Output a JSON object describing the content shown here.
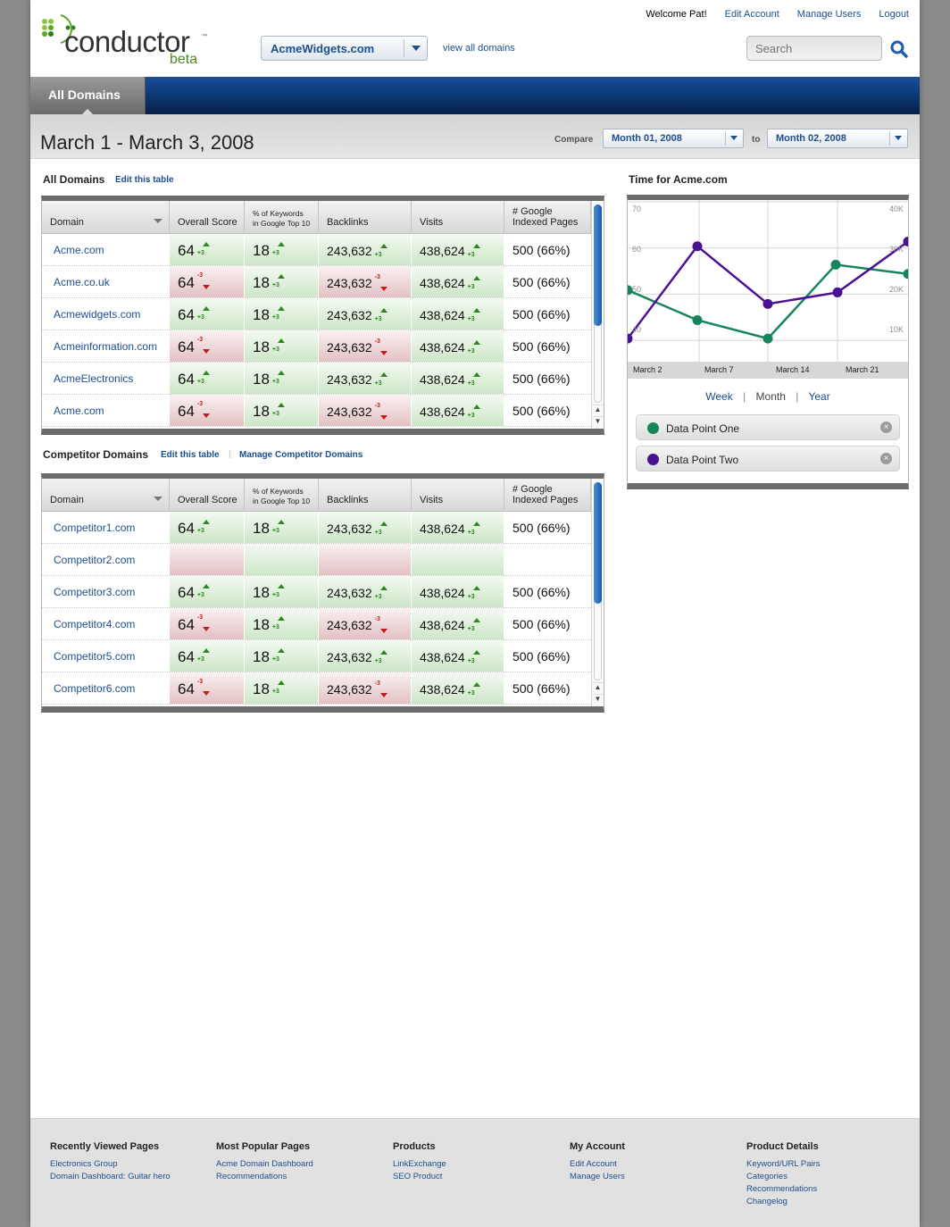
{
  "brand": {
    "name": "conductor",
    "sub": "beta",
    "tm": "™"
  },
  "toplinks": {
    "welcome": "Welcome Pat!",
    "edit_account": "Edit Account",
    "manage_users": "Manage Users",
    "logout": "Logout"
  },
  "domain_selector": {
    "value": "AcmeWidgets.com"
  },
  "view_all": "view all domains",
  "search": {
    "placeholder": "Search"
  },
  "nav": {
    "active_tab": "All Domains"
  },
  "date_range": "March 1 - March 3, 2008",
  "compare": {
    "label": "Compare",
    "from": "Month 01, 2008",
    "to_label": "to",
    "to": "Month 02, 2008"
  },
  "all_domains": {
    "title": "All Domains",
    "edit": "Edit this table",
    "headers": {
      "domain": "Domain",
      "score": "Overall Score",
      "kw1": "% of Keywords",
      "kw2": "in Google Top 10",
      "backlinks": "Backlinks",
      "visits": "Visits",
      "idx1": "# Google",
      "idx2": "Indexed Pages"
    },
    "rows": [
      {
        "domain": "Acme.com",
        "score": "64",
        "score_delta": "+3",
        "kw": "18",
        "kw_delta": "+3",
        "backlinks": "243,632",
        "bl_delta": "+3",
        "visits": "438,624",
        "v_delta": "+3",
        "indexed": "500 (66%)"
      },
      {
        "domain": "Acme.co.uk",
        "score": "64",
        "score_delta": "-3",
        "kw": "18",
        "kw_delta": "+3",
        "backlinks": "243,632",
        "bl_delta": "-3",
        "visits": "438,624",
        "v_delta": "+3",
        "indexed": "500 (66%)"
      },
      {
        "domain": "Acmewidgets.com",
        "score": "64",
        "score_delta": "+3",
        "kw": "18",
        "kw_delta": "+3",
        "backlinks": "243,632",
        "bl_delta": "+3",
        "visits": "438,624",
        "v_delta": "+3",
        "indexed": "500 (66%)"
      },
      {
        "domain": "Acmeinformation.com",
        "score": "64",
        "score_delta": "-3",
        "kw": "18",
        "kw_delta": "+3",
        "backlinks": "243,632",
        "bl_delta": "-3",
        "visits": "438,624",
        "v_delta": "+3",
        "indexed": "500 (66%)"
      },
      {
        "domain": "AcmeElectronics",
        "score": "64",
        "score_delta": "+3",
        "kw": "18",
        "kw_delta": "+3",
        "backlinks": "243,632",
        "bl_delta": "+3",
        "visits": "438,624",
        "v_delta": "+3",
        "indexed": "500 (66%)"
      },
      {
        "domain": "Acme.com",
        "score": "64",
        "score_delta": "-3",
        "kw": "18",
        "kw_delta": "+3",
        "backlinks": "243,632",
        "bl_delta": "-3",
        "visits": "438,624",
        "v_delta": "+3",
        "indexed": "500 (66%)"
      }
    ]
  },
  "competitor_domains": {
    "title": "Competitor Domains",
    "edit": "Edit this table",
    "sep": "|",
    "manage": "Manage Competitor Domains",
    "rows": [
      {
        "domain": "Competitor1.com",
        "score": "64",
        "score_delta": "+3",
        "kw": "18",
        "kw_delta": "+3",
        "backlinks": "243,632",
        "bl_delta": "+3",
        "visits": "438,624",
        "v_delta": "+3",
        "indexed": "500 (66%)"
      },
      {
        "domain": "Competitor2.com",
        "score": "",
        "score_delta": "",
        "kw": "",
        "kw_delta": "",
        "backlinks": "",
        "bl_delta": "",
        "visits": "",
        "v_delta": "",
        "indexed": ""
      },
      {
        "domain": "Competitor3.com",
        "score": "64",
        "score_delta": "+3",
        "kw": "18",
        "kw_delta": "+3",
        "backlinks": "243,632",
        "bl_delta": "+3",
        "visits": "438,624",
        "v_delta": "+3",
        "indexed": "500 (66%)"
      },
      {
        "domain": "Competitor4.com",
        "score": "64",
        "score_delta": "-3",
        "kw": "18",
        "kw_delta": "+3",
        "backlinks": "243,632",
        "bl_delta": "-3",
        "visits": "438,624",
        "v_delta": "+3",
        "indexed": "500 (66%)"
      },
      {
        "domain": "Competitor5.com",
        "score": "64",
        "score_delta": "+3",
        "kw": "18",
        "kw_delta": "+3",
        "backlinks": "243,632",
        "bl_delta": "+3",
        "visits": "438,624",
        "v_delta": "+3",
        "indexed": "500 (66%)"
      },
      {
        "domain": "Competitor6.com",
        "score": "64",
        "score_delta": "-3",
        "kw": "18",
        "kw_delta": "+3",
        "backlinks": "243,632",
        "bl_delta": "-3",
        "visits": "438,624",
        "v_delta": "+3",
        "indexed": "500 (66%)"
      }
    ]
  },
  "chart_panel": {
    "title": "Time for Acme.com",
    "periods": [
      "Week",
      "Month",
      "Year"
    ],
    "period_sep": "|"
  },
  "chart_data": {
    "type": "line",
    "title": "Time for Acme.com",
    "categories": [
      "March 2",
      "March 7",
      "March 14",
      "March 21"
    ],
    "x": [
      1,
      2,
      3,
      4,
      5,
      6,
      7
    ],
    "y_left": {
      "ticks": [
        "70",
        "60",
        "50",
        "40"
      ],
      "lim": [
        35,
        70
      ]
    },
    "y_right": {
      "ticks": [
        "40K",
        "30K",
        "20K",
        "10K"
      ],
      "lim": [
        0,
        40000
      ]
    },
    "grid": true,
    "series": [
      {
        "name": "Data Point One",
        "color": "#16865a",
        "values": [
          50.5,
          44,
          40,
          56,
          54
        ]
      },
      {
        "name": "Data Point Two",
        "color": "#4a1292",
        "values": [
          40,
          60,
          47.5,
          50,
          61
        ]
      }
    ]
  },
  "colors": {
    "accent": "#1c4f8e",
    "positive": "#2a8a1c",
    "negative": "#c01e1e"
  },
  "footer": {
    "cols": [
      {
        "title": "Recently Viewed Pages",
        "links": [
          "Electronics Group",
          "Domain Dashboard: Guitar hero"
        ]
      },
      {
        "title": "Most Popular Pages",
        "links": [
          "Acme Domain Dashboard",
          "Recommendations"
        ]
      },
      {
        "title": "Products",
        "links": [
          "LinkExchange",
          "SEO Product"
        ]
      },
      {
        "title": "My Account",
        "links": [
          "Edit Account",
          "Manage Users"
        ]
      },
      {
        "title": "Product Details",
        "links": [
          "Keyword/URL Pairs",
          "Categories",
          "Recommendations",
          "Changelog"
        ]
      }
    ]
  }
}
